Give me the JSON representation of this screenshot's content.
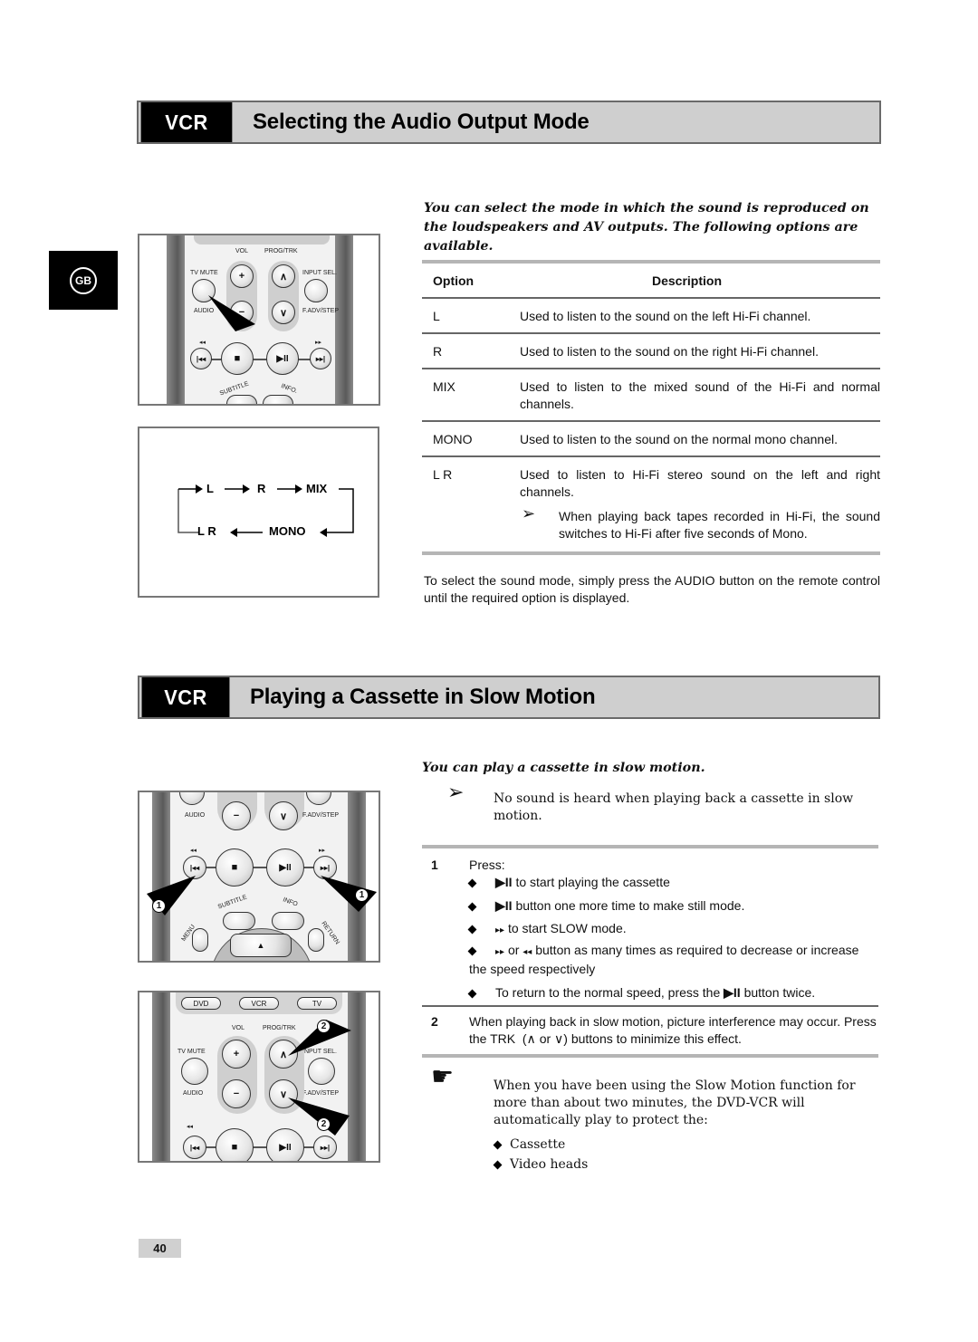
{
  "side_badge": {
    "label": "GB"
  },
  "section1": {
    "tag": "VCR",
    "title": "Selecting the Audio Output Mode",
    "intro": "You can select the mode in which the sound is reproduced on the loudspeakers and AV outputs. The following options are available.",
    "table": {
      "headers": [
        "Option",
        "Description"
      ],
      "rows": [
        {
          "option": "L",
          "description": "Used to listen to the sound on the left Hi-Fi channel."
        },
        {
          "option": "R",
          "description": "Used to listen to the sound on the right Hi-Fi channel."
        },
        {
          "option": "MIX",
          "description": "Used to listen to the mixed sound of the Hi-Fi and normal channels."
        },
        {
          "option": "MONO",
          "description": "Used to listen to the sound on the normal mono channel."
        },
        {
          "option": "L R",
          "description": "Used to listen to Hi-Fi stereo sound on the left and right channels.",
          "note": "When playing back tapes recorded in Hi-Fi, the sound switches to Hi-Fi after five seconds of Mono."
        }
      ]
    },
    "footer_text": "To select the sound mode, simply press the AUDIO button on the remote control until the required option is displayed.",
    "flow_diagram": {
      "items": [
        "L",
        "R",
        "MIX",
        "MONO",
        "L R"
      ]
    },
    "remote_labels": {
      "vol": "VOL",
      "prog_trk": "PROG/TRK",
      "tv_mute": "TV MUTE",
      "input_sel": "INPUT SEL.",
      "audio": "AUDIO",
      "f_adv_step": "F.ADV/STEP",
      "subtitle": "SUBTITLE",
      "info": "INFO."
    }
  },
  "section2": {
    "tag": "VCR",
    "title": "Playing a Cassette in Slow Motion",
    "intro": "You can play a cassette in slow motion.",
    "note": "No sound is heard when playing back a cassette in slow motion.",
    "steps": [
      {
        "number": "1",
        "lead": "Press:",
        "bullets": [
          {
            "icon": "play-pause",
            "text": "to start playing the cassette"
          },
          {
            "icon": "play-pause",
            "text": "button one more time to make still mode."
          },
          {
            "icon": "fast-forward",
            "text": "to start SLOW mode."
          },
          {
            "icon": "fast-forward",
            "mid": "or",
            "icon2": "rewind",
            "text": "button as many times as required to decrease or increase the speed respectively"
          },
          {
            "prefix": "To return to the normal speed, press the",
            "icon": "play-pause",
            "text": "button twice."
          }
        ]
      },
      {
        "number": "2",
        "text_a": "When playing back in slow motion, picture interference may occur. Press the TRK",
        "text_b": "(∧  or ∨)",
        "text_c": "buttons to minimize this effect."
      }
    ],
    "caution": {
      "text": "When you have been using the Slow Motion function for more than about two minutes, the DVD-VCR will automatically play to protect the:",
      "items": [
        "Cassette",
        "Video heads"
      ]
    },
    "remote_labels": {
      "audio": "AUDIO",
      "f_adv_step": "F.ADV/STEP",
      "subtitle": "SUBTITLE",
      "info": "INFO",
      "menu": "MENU",
      "return": "RETURN",
      "dvd": "DVD",
      "vcr": "VCR",
      "tv": "TV",
      "vol": "VOL",
      "prog_trk": "PROG/TRK",
      "tv_mute": "TV MUTE",
      "input_sel": "INPUT SEL.",
      "callout_1": "1",
      "callout_2": "2"
    }
  },
  "glyphs": {
    "play_pause": "▶II",
    "ff": "▸▸",
    "rew": "◂◂",
    "stop": "■",
    "plus": "+",
    "minus": "−",
    "up": "∧",
    "down": "∨",
    "note_arrow": "➢",
    "hand": "☛"
  },
  "page_number": "40"
}
